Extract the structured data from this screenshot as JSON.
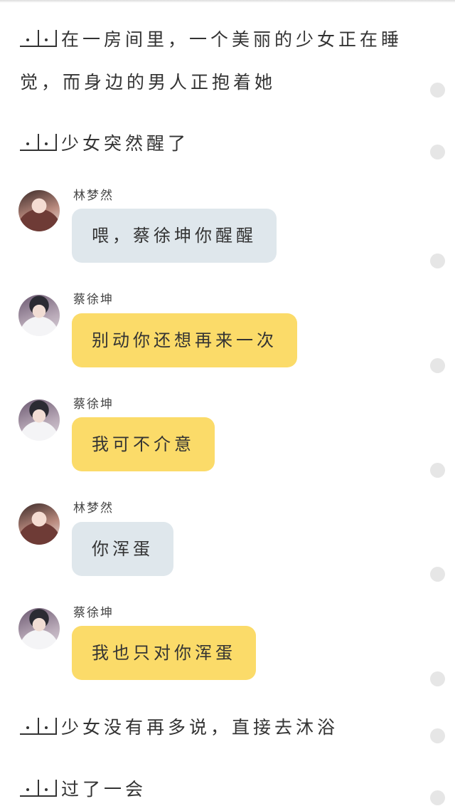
{
  "narrations": [
    {
      "text": "在一房间里，一个美丽的少女正在睡觉，而身边的男人正抱着她"
    },
    {
      "text": "少女突然醒了"
    },
    {
      "text": "少女没有再多说，直接去沐浴"
    },
    {
      "text": "过了一会"
    }
  ],
  "messages": [
    {
      "sender": "林梦然",
      "text": "喂，蔡徐坤你醒醒",
      "bubble_color": "#dfe7ec"
    },
    {
      "sender": "蔡徐坤",
      "text": "别动你还想再来一次",
      "bubble_color": "#fbdb69"
    },
    {
      "sender": "蔡徐坤",
      "text": "我可不介意",
      "bubble_color": "#fbdb69"
    },
    {
      "sender": "林梦然",
      "text": "你浑蛋",
      "bubble_color": "#dfe7ec"
    },
    {
      "sender": "蔡徐坤",
      "text": "我也只对你浑蛋",
      "bubble_color": "#fbdb69"
    }
  ]
}
